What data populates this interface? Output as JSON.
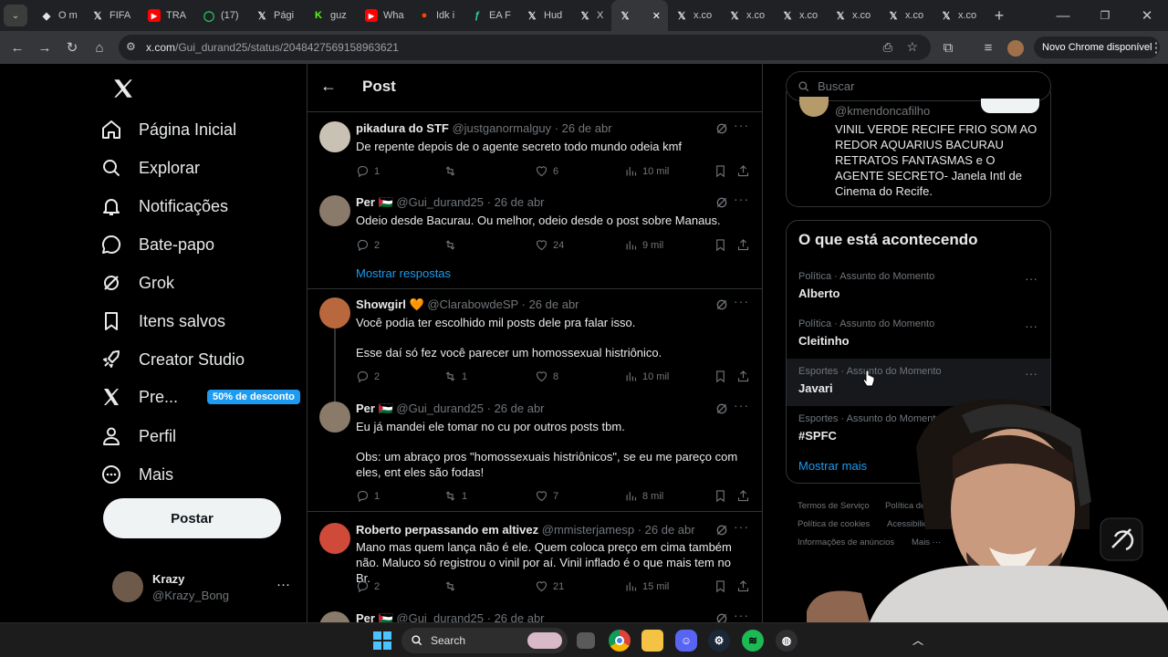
{
  "browser": {
    "tabs": [
      {
        "label": "O m",
        "icon": "github-icon",
        "color": "#e3e3e3"
      },
      {
        "label": "FIFA",
        "icon": "x-icon",
        "color": "#e3e3e3"
      },
      {
        "label": "TRA",
        "icon": "youtube-icon",
        "color": "#ff0000"
      },
      {
        "label": "(17)",
        "icon": "whatsapp-icon",
        "color": "#25d366"
      },
      {
        "label": "Pági",
        "icon": "x-icon",
        "color": "#e3e3e3"
      },
      {
        "label": "guz",
        "icon": "kick-icon",
        "color": "#53fc18"
      },
      {
        "label": "Wha",
        "icon": "youtube-icon",
        "color": "#ff0000"
      },
      {
        "label": "Idk i",
        "icon": "reddit-icon",
        "color": "#ff4500"
      },
      {
        "label": "EA F",
        "icon": "futbin-icon",
        "color": "#2dd4a7"
      },
      {
        "label": "Hud",
        "icon": "x-icon",
        "color": "#e3e3e3"
      },
      {
        "label": "X",
        "icon": "x-icon",
        "color": "#e3e3e3"
      },
      {
        "label": "",
        "icon": "x-icon",
        "color": "#e3e3e3",
        "active": true
      },
      {
        "label": "x.co",
        "icon": "x-icon",
        "color": "#e3e3e3"
      },
      {
        "label": "x.co",
        "icon": "x-icon",
        "color": "#e3e3e3"
      },
      {
        "label": "x.co",
        "icon": "x-icon",
        "color": "#e3e3e3"
      },
      {
        "label": "x.co",
        "icon": "x-icon",
        "color": "#e3e3e3"
      },
      {
        "label": "x.co",
        "icon": "x-icon",
        "color": "#e3e3e3"
      },
      {
        "label": "x.co",
        "icon": "x-icon",
        "color": "#e3e3e3"
      }
    ],
    "new_tab": "+",
    "url_domain": "x.com",
    "url_path": "/Gui_durand25/status/2048427569158963621",
    "update_label": "Novo Chrome disponível"
  },
  "nav": {
    "items": [
      {
        "label": "Página Inicial",
        "icon": "home-icon"
      },
      {
        "label": "Explorar",
        "icon": "search-icon"
      },
      {
        "label": "Notificações",
        "icon": "bell-icon"
      },
      {
        "label": "Bate-papo",
        "icon": "chat-icon"
      },
      {
        "label": "Grok",
        "icon": "grok-icon"
      },
      {
        "label": "Itens salvos",
        "icon": "bookmark-icon"
      },
      {
        "label": "Creator Studio",
        "icon": "rocket-icon"
      },
      {
        "label": "Pre...",
        "icon": "x-icon"
      },
      {
        "label": "Perfil",
        "icon": "person-icon"
      },
      {
        "label": "Mais",
        "icon": "more-circle-icon"
      }
    ],
    "premium_badge": "50% de desconto",
    "post_button": "Postar",
    "account": {
      "name": "Krazy",
      "handle": "@Krazy_Bong",
      "more": "···"
    }
  },
  "main": {
    "title": "Post",
    "show_replies": "Mostrar respostas",
    "posts": [
      {
        "name": "pikadura do STF",
        "handle": "@justganormalguy",
        "date": "· 26 de abr",
        "text": "De repente depois de o agente secreto todo mundo odeia kmf",
        "replies": "1",
        "reposts": "",
        "likes": "6",
        "views": "10 mil",
        "avatar_color": "#c9c2b4"
      },
      {
        "name": "Per 🇵🇸",
        "handle": "@Gui_durand25",
        "date": "· 26 de abr",
        "text": "Odeio desde Bacurau. Ou melhor, odeio desde o post sobre Manaus.",
        "replies": "2",
        "reposts": "",
        "likes": "24",
        "views": "9 mil",
        "avatar_color": "#8a7a6a"
      },
      {
        "name": "Showgirl 🧡",
        "handle": "@ClarabowdeSP",
        "date": "· 26 de abr",
        "text": "Você podia ter escolhido mil posts dele pra falar isso.",
        "text2": "Esse daí só fez você parecer um homossexual histriônico.",
        "replies": "2",
        "reposts": "1",
        "likes": "8",
        "views": "10 mil",
        "avatar_color": "#b8683c"
      },
      {
        "name": "Per 🇵🇸",
        "handle": "@Gui_durand25",
        "date": "· 26 de abr",
        "text": "Eu já mandei ele tomar no cu por outros posts tbm.",
        "text2": "Obs: um abraço pros \"homossexuais histriônicos\", se eu me pareço com eles, ent eles são fodas!",
        "replies": "1",
        "reposts": "1",
        "likes": "7",
        "views": "8 mil",
        "avatar_color": "#8a7a6a"
      },
      {
        "name": "Roberto perpassando em altivez",
        "handle": "@mmisterjamesp",
        "date": "· 26 de abr",
        "text": "Mano mas quem lança não é ele. Quem coloca preço em cima também não. Maluco só registrou o vinil por aí. Vinil inflado é o que mais tem no Br.",
        "replies": "2",
        "reposts": "",
        "likes": "21",
        "views": "15 mil",
        "avatar_color": "#d04a3a"
      },
      {
        "name": "Per 🇵🇸",
        "handle": "@Gui_durand25",
        "date": "· 26 de abr",
        "text": "",
        "avatar_color": "#8a7a6a"
      }
    ]
  },
  "right": {
    "search_placeholder": "Buscar",
    "top_card": {
      "handle": "@kmendoncafilho",
      "text": "VINIL VERDE RECIFE FRIO SOM AO REDOR AQUARIUS BACURAU RETRATOS FANTASMAS e O AGENTE SECRETO- Janela Intl de Cinema do Recife."
    },
    "trends_title": "O que está acontecendo",
    "trends": [
      {
        "category": "Política · Assunto do Momento",
        "title": "Alberto"
      },
      {
        "category": "Política · Assunto do Momento",
        "title": "Cleitinho"
      },
      {
        "category": "Esportes · Assunto do Momento",
        "title": "Javari"
      },
      {
        "category": "Esportes · Assunto do Momento",
        "title": "#SPFC"
      }
    ],
    "show_more": "Mostrar mais",
    "footer": [
      "Termos de Serviço",
      "Política de Privacidade",
      "Política de cookies",
      "Acessibilidade",
      "Informações de anúncios",
      "Mais ···"
    ]
  },
  "taskbar": {
    "search_label": "Search"
  },
  "colors": {
    "accent": "#1d9bf0",
    "bg": "#000000",
    "border": "#2f3336",
    "muted": "#71767b"
  }
}
